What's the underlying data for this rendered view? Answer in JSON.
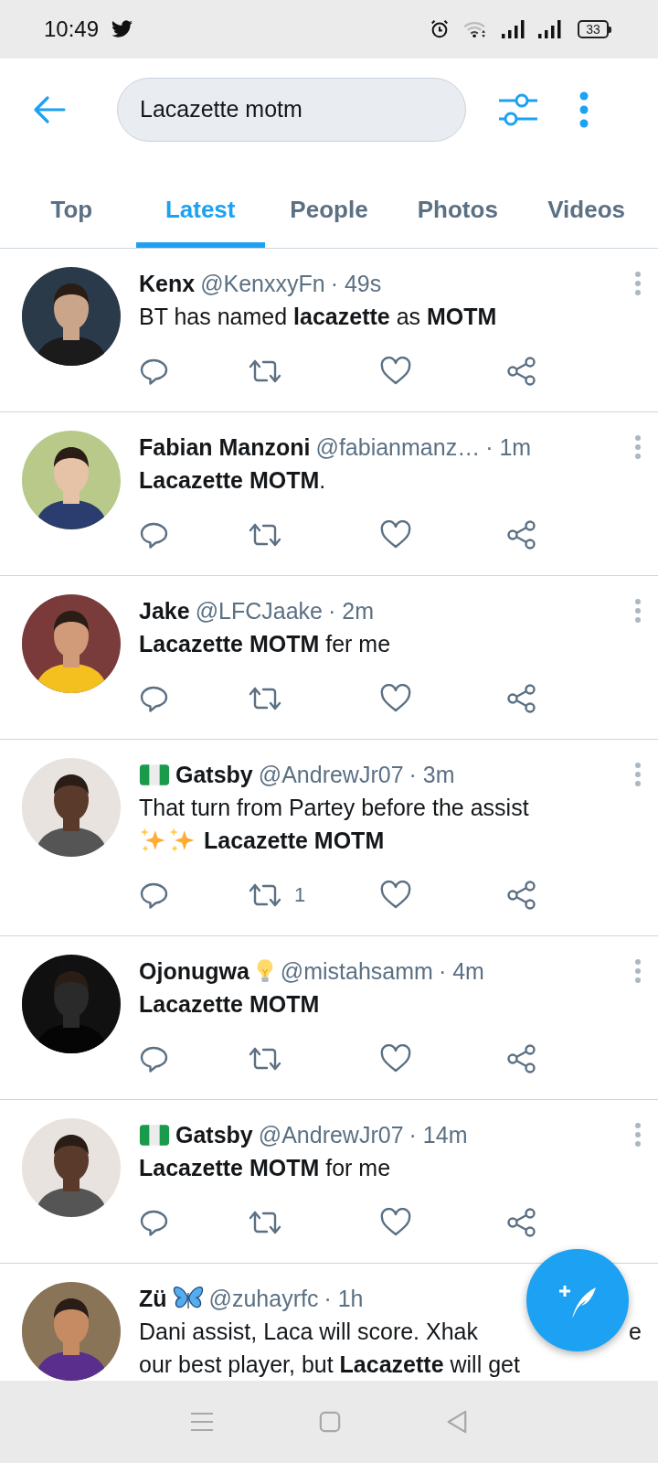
{
  "status_bar": {
    "time": "10:49",
    "battery": "33"
  },
  "search": {
    "value": "Lacazette motm"
  },
  "tabs": [
    {
      "label": "Top",
      "selected": false
    },
    {
      "label": "Latest",
      "selected": true
    },
    {
      "label": "People",
      "selected": false
    },
    {
      "label": "Photos",
      "selected": false
    },
    {
      "label": "Videos",
      "selected": false
    }
  ],
  "tweets": [
    {
      "name": "Kenx",
      "handle": "@KenxxyFn",
      "time": "· 49s",
      "more_menu": true,
      "body": [
        {
          "kind": "text",
          "text": "BT has named **lacazette** as **MOTM**"
        }
      ]
    },
    {
      "name": "Fabian Manzoni",
      "handle": "@fabianmanz…",
      "time": "· 1m",
      "more_menu": true,
      "body": [
        {
          "kind": "text",
          "text": "**Lacazette MOTM**."
        }
      ]
    },
    {
      "name": "Jake",
      "handle": "@LFCJaake",
      "time": "· 2m",
      "more_menu": true,
      "body": [
        {
          "kind": "text",
          "text": "**Lacazette MOTM** fer me"
        }
      ]
    },
    {
      "name": "Gatsby",
      "name_icon_before": {
        "kind": "flag"
      },
      "handle": "@AndrewJr07",
      "time": "· 3m",
      "more_menu": true,
      "body": [
        {
          "kind": "text",
          "text": "That turn from Partey before the assist"
        },
        {
          "kind": "break"
        },
        {
          "kind": "sparkles"
        },
        {
          "kind": "sparkles"
        },
        {
          "kind": "text",
          "text": " **Lacazette MOTM**"
        }
      ],
      "retweets": "1"
    },
    {
      "name": "Ojonugwa",
      "name_icon_after": {
        "kind": "bulb"
      },
      "handle": "@mistahsamm",
      "time": "· 4m",
      "more_menu": true,
      "body": [
        {
          "kind": "text",
          "text": "**Lacazette MOTM**"
        }
      ]
    },
    {
      "name": "Gatsby",
      "name_icon_before": {
        "kind": "flag"
      },
      "handle": "@AndrewJr07",
      "time": "· 14m",
      "more_menu": true,
      "body": [
        {
          "kind": "text",
          "text": "**Lacazette MOTM** for me"
        }
      ]
    },
    {
      "name": "Zü",
      "name_icon_after": {
        "kind": "butterfly"
      },
      "handle": "@zuhayrfc",
      "time": "· 1h",
      "more_menu": false,
      "body": [
        {
          "kind": "text",
          "text": "Dani assist, Laca will score. Xhak"
        },
        {
          "kind": "gap"
        },
        {
          "kind": "text",
          "text": "e"
        },
        {
          "kind": "break"
        },
        {
          "kind": "text",
          "text": "our best player, but **Lacazette** will get"
        }
      ]
    }
  ]
}
